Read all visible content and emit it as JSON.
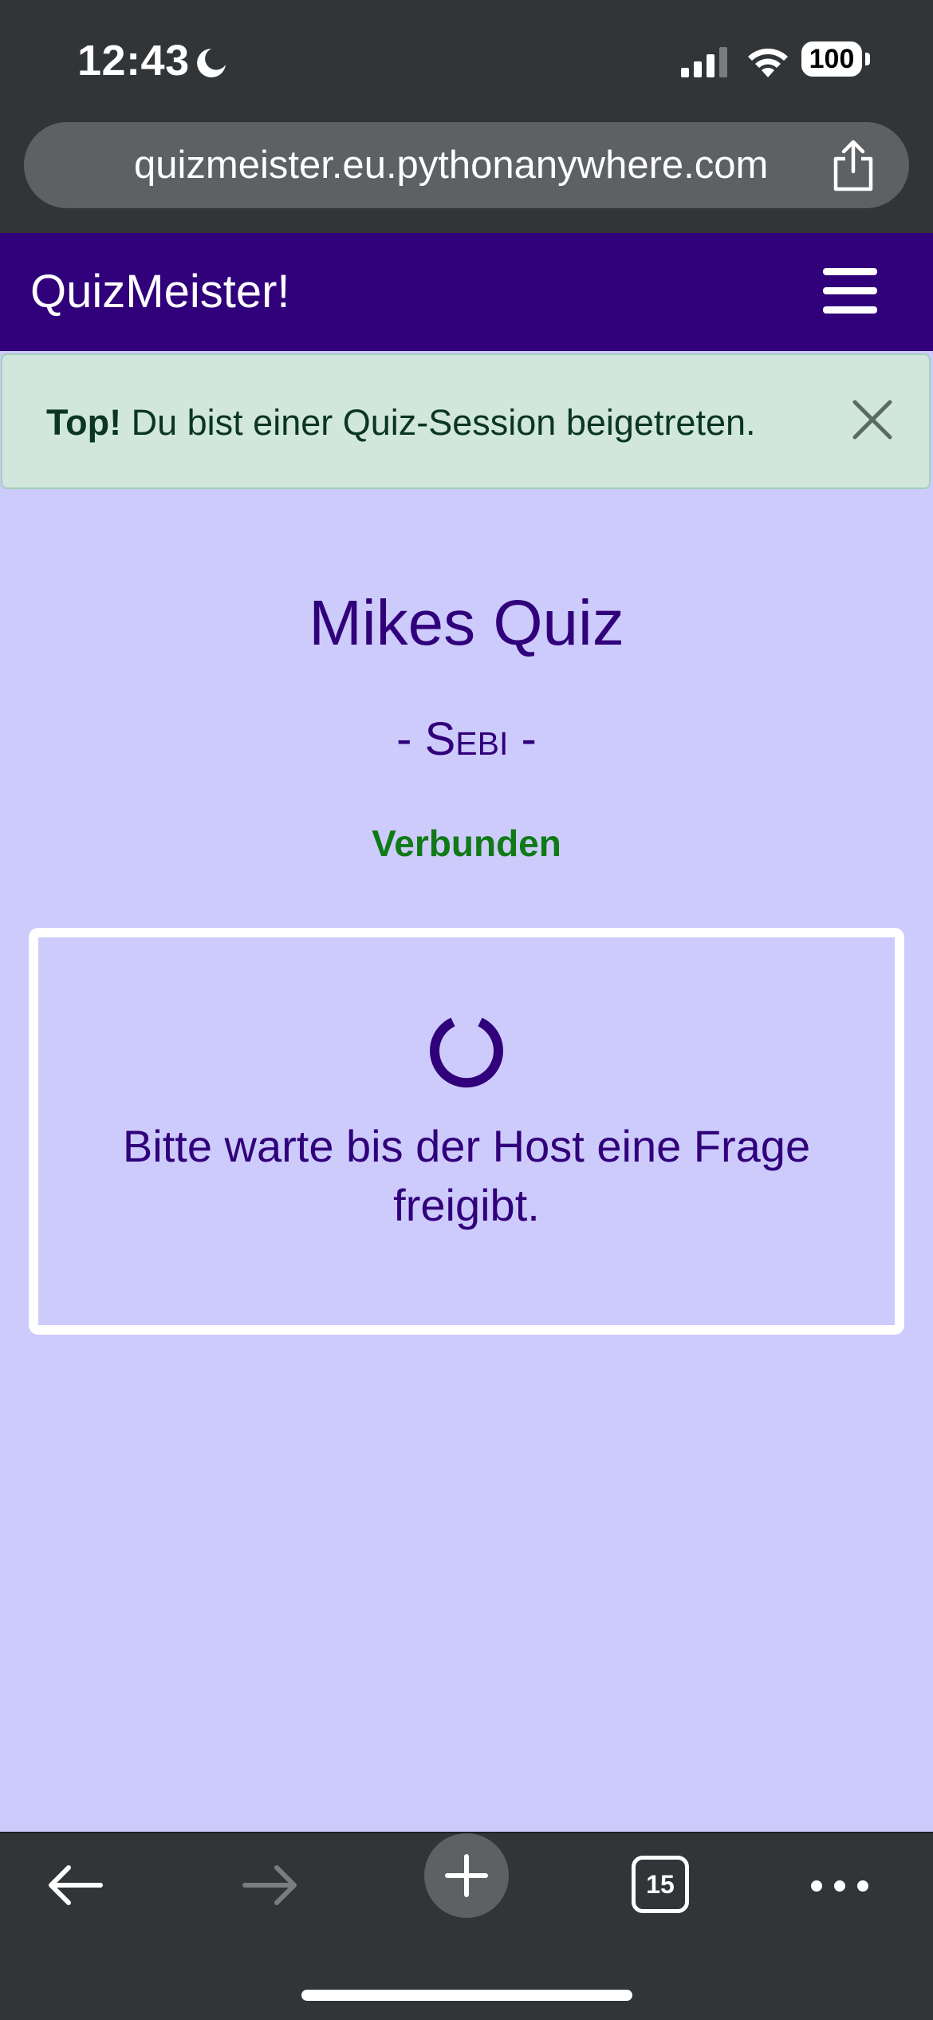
{
  "status_bar": {
    "time": "12:43",
    "battery": "100",
    "icons": [
      "moon-icon",
      "signal-icon",
      "wifi-icon",
      "battery-icon"
    ]
  },
  "browser": {
    "url": "quizmeister.eu.pythonanywhere.com",
    "tab_count": "15",
    "toolbar_icons": [
      "back-arrow-icon",
      "forward-arrow-icon",
      "plus-icon",
      "tabs-icon",
      "more-icon"
    ]
  },
  "navbar": {
    "brand": "QuizMeister!"
  },
  "alert": {
    "strong": "Top!",
    "message": " Du bist einer Quiz-Session beigetreten."
  },
  "quiz": {
    "title": "Mikes Quiz",
    "player": "- Sebi -",
    "connection_status": "Verbunden",
    "wait_message": "Bitte warte bis der Host eine Frage freigibt."
  },
  "colors": {
    "page_bg": "#cdcbfb",
    "navbar_bg": "#31007b",
    "accent": "#31007b",
    "alert_bg": "#d1e7dd",
    "connected": "#0f7a16",
    "chrome_bg": "#323538"
  }
}
